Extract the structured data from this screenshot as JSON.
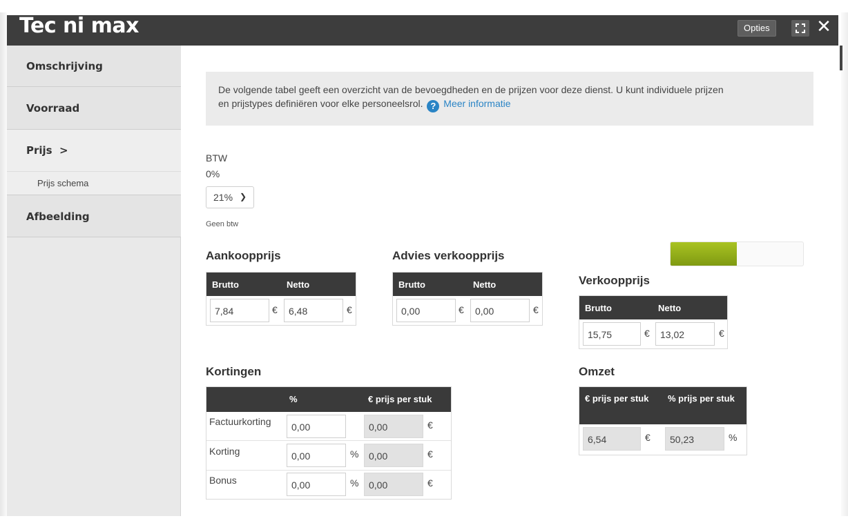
{
  "window": {
    "title": "Tec ni max",
    "options_label": "Opties"
  },
  "sidebar": {
    "items": [
      {
        "label": "Omschrijving"
      },
      {
        "label": "Voorraad"
      },
      {
        "label": "Prijs  >"
      },
      {
        "label": "Prijs schema"
      },
      {
        "label": "Afbeelding"
      }
    ]
  },
  "info": {
    "text_line1": "De volgende tabel geeft een overzicht van de bevoegdheden en de prijzen voor deze dienst. U kunt individuele prijzen",
    "text_line2": "en prijstypes definiëren voor elke personeelsrol.",
    "link": "Meer informatie"
  },
  "btw": {
    "label": "BTW",
    "option_0": "0%",
    "selected": "21%",
    "option_none": "Geen btw"
  },
  "aankoopprijs": {
    "title": "Aankoopprijs",
    "headers": [
      "Brutto",
      "Netto"
    ],
    "brutto": "7,84",
    "netto": "6,48",
    "currency": "€"
  },
  "advies": {
    "title": "Advies verkoopprijs",
    "headers": [
      "Brutto",
      "Netto"
    ],
    "brutto": "0,00",
    "netto": "0,00",
    "currency": "€"
  },
  "margin_bar": {
    "fill_fraction": 0.5,
    "color": "#95b01a"
  },
  "verkoopprijs": {
    "title": "Verkoopprijs",
    "headers": [
      "Brutto",
      "Netto"
    ],
    "brutto": "15,75",
    "netto": "13,02",
    "currency": "€"
  },
  "kortingen": {
    "title": "Kortingen",
    "headers": [
      "",
      "%",
      "€ prijs per stuk"
    ],
    "rows": [
      {
        "label": "Factuurkorting",
        "percent": "0,00",
        "percent_unit": "",
        "price": "0,00",
        "currency": "€"
      },
      {
        "label": "Korting",
        "percent": "0,00",
        "percent_unit": "%",
        "price": "0,00",
        "currency": "€"
      },
      {
        "label": "Bonus",
        "percent": "0,00",
        "percent_unit": "%",
        "price": "0,00",
        "currency": "€"
      }
    ]
  },
  "omzet": {
    "title": "Omzet",
    "headers": [
      "€ prijs per stuk",
      "% prijs per stuk"
    ],
    "price": "6,54",
    "currency": "€",
    "percent": "50,23",
    "percent_unit": "%"
  }
}
